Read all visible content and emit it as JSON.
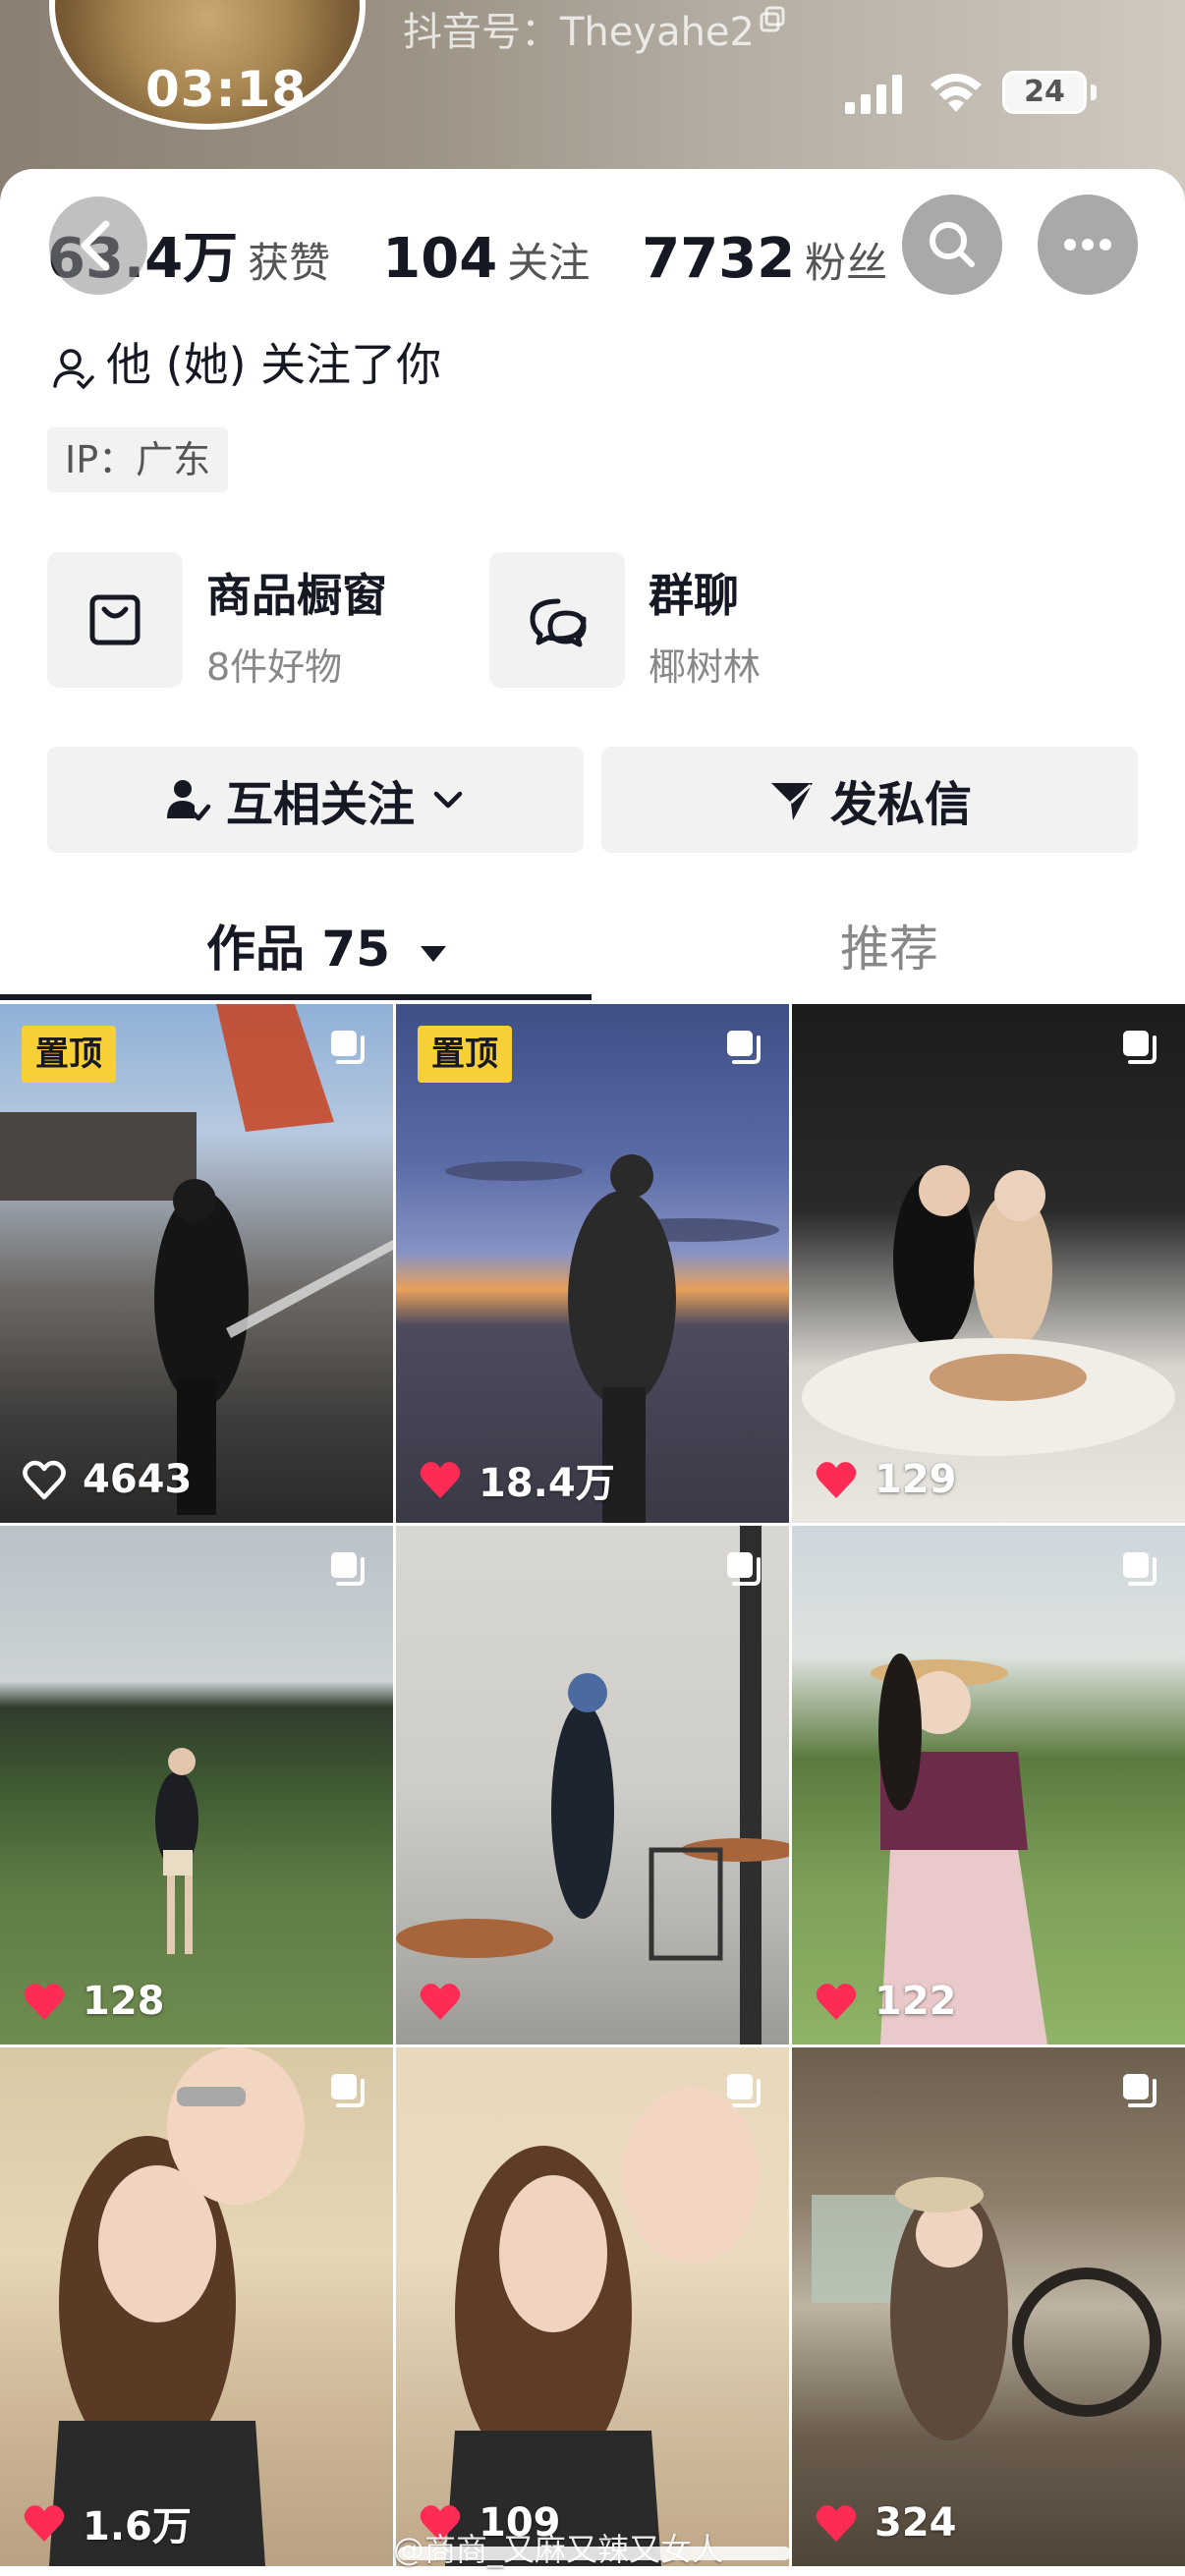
{
  "status_bar": {
    "time": "03:18",
    "battery": "24"
  },
  "profile": {
    "douyin_id": "抖音号：Theyahe2",
    "stats": [
      {
        "num": "63.4万",
        "label": "获赞"
      },
      {
        "num": "104",
        "label": "关注"
      },
      {
        "num": "7732",
        "label": "粉丝"
      }
    ],
    "follow_note": "他 (她) 关注了你",
    "ip": "IP：广东"
  },
  "cards": {
    "shop": {
      "title": "商品橱窗",
      "sub": "8件好物"
    },
    "group": {
      "title": "群聊",
      "sub": "椰树林"
    }
  },
  "actions": {
    "follow": "互相关注",
    "message": "发私信"
  },
  "tabs": {
    "works": "作品 75",
    "recommend": "推荐"
  },
  "grid": {
    "pin_label": "置顶",
    "tiles": [
      {
        "likes": "4643",
        "pinned": true,
        "liked": false
      },
      {
        "likes": "18.4万",
        "pinned": true,
        "liked": true
      },
      {
        "likes": "129",
        "pinned": false,
        "liked": true
      },
      {
        "likes": "128",
        "pinned": false,
        "liked": true
      },
      {
        "likes": "",
        "pinned": false,
        "liked": true
      },
      {
        "likes": "122",
        "pinned": false,
        "liked": true
      },
      {
        "likes": "1.6万",
        "pinned": false,
        "liked": true
      },
      {
        "likes": "109",
        "pinned": false,
        "liked": true
      },
      {
        "likes": "324",
        "pinned": false,
        "liked": true
      }
    ]
  },
  "watermark": "@商商_又麻又辣又女人",
  "colors": {
    "pin": "#f7d038",
    "like": "#fe2c55",
    "text": "#161823"
  }
}
